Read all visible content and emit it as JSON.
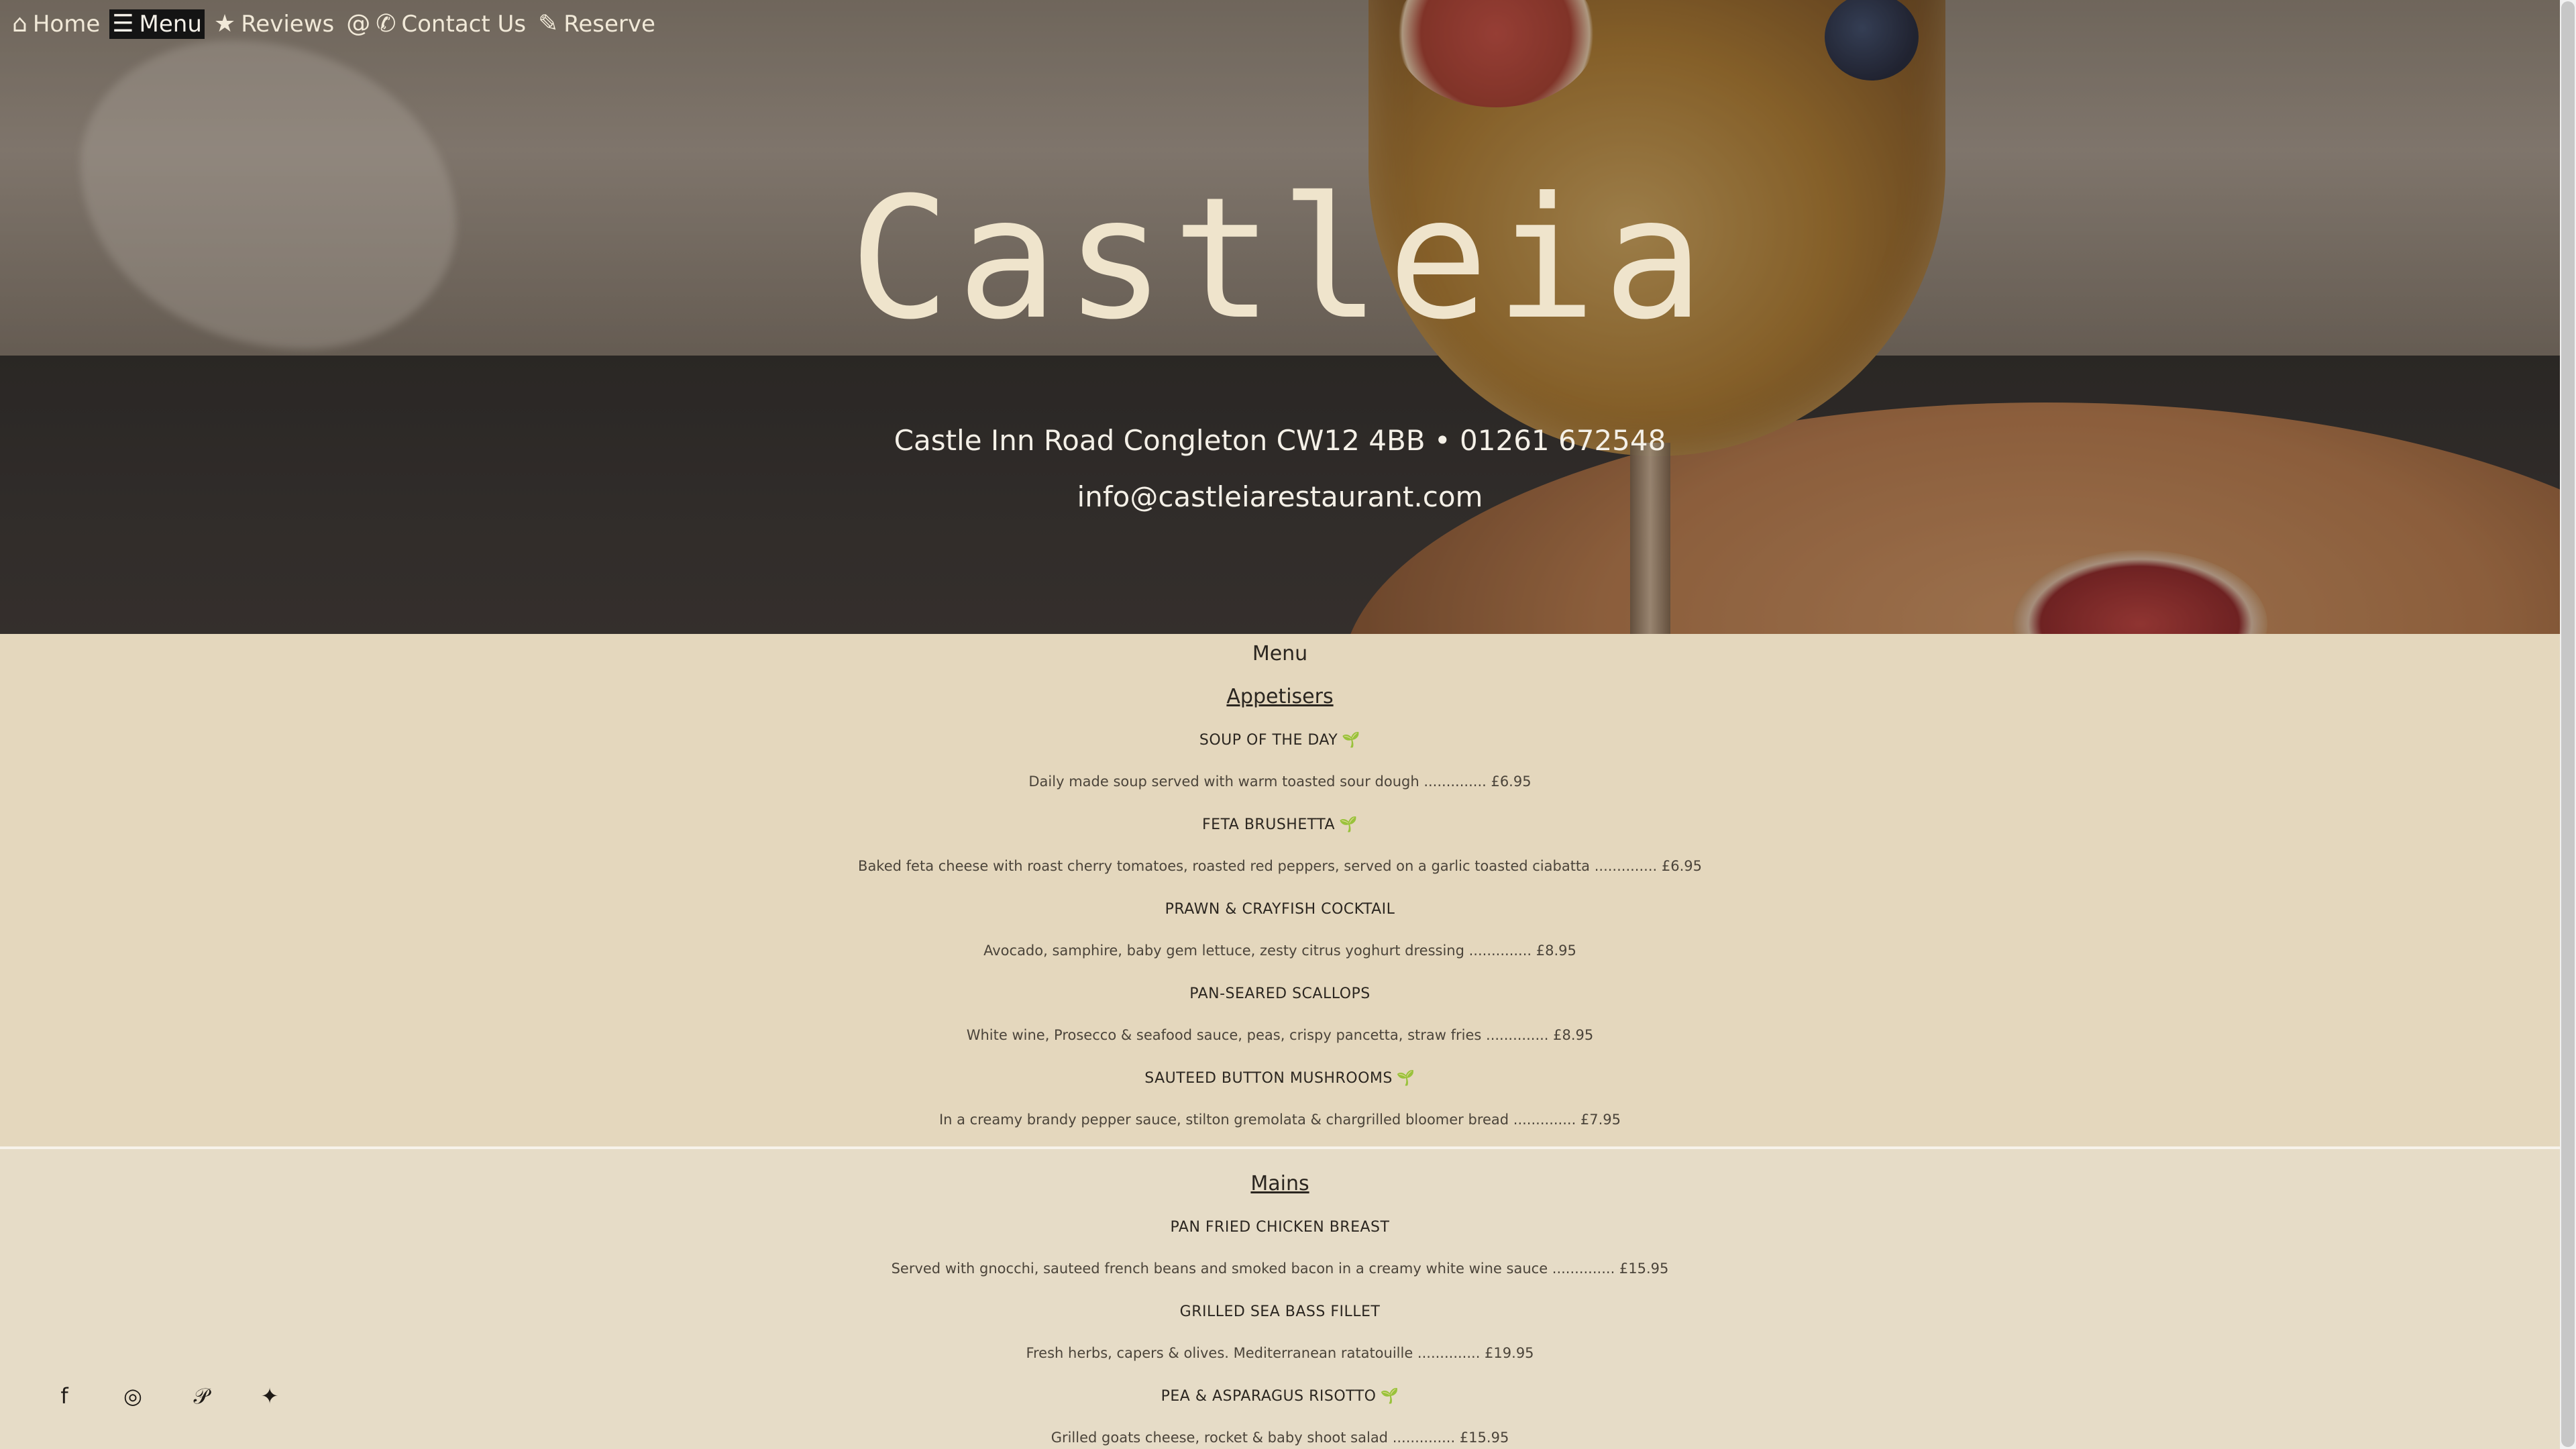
{
  "nav": {
    "items": [
      {
        "label": "Home",
        "icon": "home-icon"
      },
      {
        "label": "Menu",
        "icon": "menu-card-icon",
        "active": true
      },
      {
        "label": "Reviews",
        "icon": "star-icon"
      },
      {
        "label": "Contact Us",
        "icon": "at-phone-icon"
      },
      {
        "label": "Reserve",
        "icon": "edit-icon"
      }
    ]
  },
  "hero": {
    "brand": "Castleia",
    "address": "Castle Inn Road Congleton CW12 4BB • 01261 672548",
    "email": "info@castleiarestaurant.com"
  },
  "menu": {
    "title": "Menu",
    "sections": [
      {
        "heading": "Appetisers",
        "dishes": [
          {
            "name": "SOUP OF THE DAY",
            "veg": true,
            "desc": "Daily made soup served with warm toasted sour dough .............. £6.95"
          },
          {
            "name": "FETA BRUSHETTA",
            "veg": true,
            "desc": "Baked feta cheese with roast cherry tomatoes, roasted red peppers, served on a garlic toasted ciabatta .............. £6.95"
          },
          {
            "name": "PRAWN & CRAYFISH COCKTAIL",
            "veg": false,
            "desc": "Avocado, samphire, baby gem lettuce, zesty citrus yoghurt dressing .............. £8.95"
          },
          {
            "name": "PAN-SEARED SCALLOPS",
            "veg": false,
            "desc": "White wine, Prosecco & seafood sauce, peas, crispy pancetta, straw fries .............. £8.95"
          },
          {
            "name": "SAUTEED BUTTON MUSHROOMS",
            "veg": true,
            "desc": "In a creamy brandy pepper sauce, stilton gremolata & chargrilled bloomer bread .............. £7.95"
          }
        ]
      },
      {
        "heading": "Mains",
        "dishes": [
          {
            "name": "PAN FRIED CHICKEN BREAST",
            "veg": false,
            "desc": "Served with gnocchi, sauteed french beans and smoked bacon in a creamy white wine sauce .............. £15.95"
          },
          {
            "name": "GRILLED SEA BASS FILLET",
            "veg": false,
            "desc": "Fresh herbs, capers & olives. Mediterranean ratatouille .............. £19.95"
          },
          {
            "name": "PEA & ASPARAGUS RISOTTO",
            "veg": true,
            "desc": "Grilled goats cheese, rocket & baby shoot salad .............. £15.95"
          }
        ]
      }
    ]
  },
  "icons": {
    "veg": "🌱",
    "home": "⌂",
    "menu": "☰",
    "star": "★",
    "at": "@",
    "phone": "✆",
    "edit": "✎"
  },
  "social": [
    {
      "name": "facebook-icon",
      "glyph": "f"
    },
    {
      "name": "instagram-icon",
      "glyph": "◎"
    },
    {
      "name": "pinterest-icon",
      "glyph": "𝒫"
    },
    {
      "name": "twitter-icon",
      "glyph": "✦"
    }
  ],
  "colors": {
    "menu_bg": "#e4d7bd",
    "nav_active_bg": "#141414",
    "brand_text": "#efe4cc"
  }
}
